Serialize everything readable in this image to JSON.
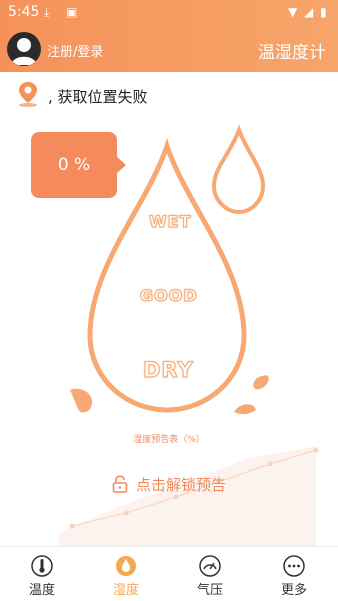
{
  "status_bar": {
    "time": "5:45"
  },
  "header": {
    "login_label": "注册/登录",
    "title": "温湿度计"
  },
  "location": {
    "text": ", 获取位置失败"
  },
  "humidity": {
    "value": 0,
    "bubble_text": "0 %",
    "levels": {
      "wet": "WET",
      "good": "GOOD",
      "dry": "DRY"
    }
  },
  "forecast": {
    "label": "湿度预告表（%）",
    "unlock_label": "点击解锁预告"
  },
  "tabs": [
    {
      "label": "温度",
      "icon": "thermometer-icon",
      "active": false
    },
    {
      "label": "湿度",
      "icon": "water-drop-icon",
      "active": true
    },
    {
      "label": "气压",
      "icon": "gauge-icon",
      "active": false
    },
    {
      "label": "更多",
      "icon": "more-icon",
      "active": false
    }
  ],
  "colors": {
    "accent": "#f5925a",
    "active_tab": "#f5a94f",
    "drop_stroke": "#f7a873"
  }
}
